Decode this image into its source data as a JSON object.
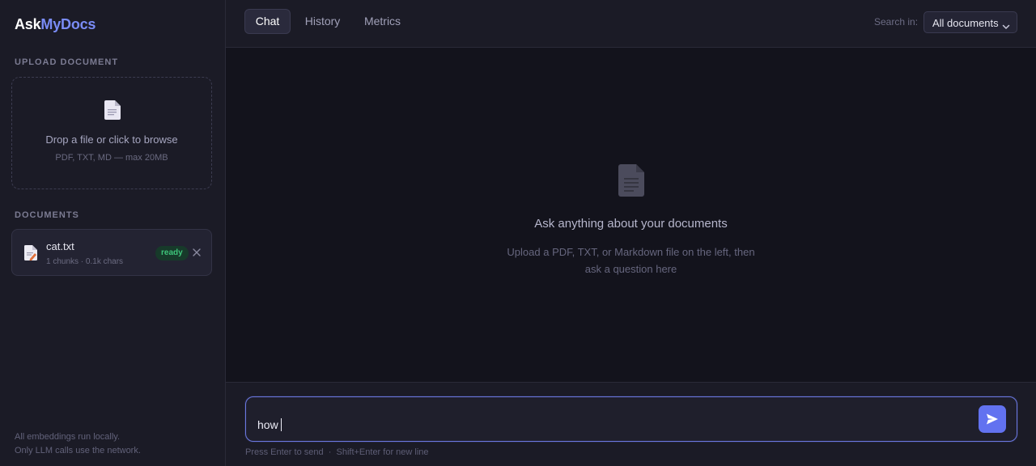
{
  "app": {
    "logo_a": "Ask",
    "logo_b": "MyDocs"
  },
  "sidebar": {
    "upload_label": "UPLOAD DOCUMENT",
    "dropzone": {
      "title": "Drop a file or click to browse",
      "subtitle": "PDF, TXT, MD — max 20MB",
      "icon": "document-icon"
    },
    "documents_label": "DOCUMENTS",
    "documents": [
      {
        "name": "cat.txt",
        "meta": "1 chunks · 0.1k chars",
        "status": "ready",
        "icon": "text-file-icon"
      }
    ],
    "footnote_line1": "All embeddings run locally.",
    "footnote_line2": "Only LLM calls use the network."
  },
  "header": {
    "tabs": [
      {
        "label": "Chat",
        "active": true
      },
      {
        "label": "History",
        "active": false
      },
      {
        "label": "Metrics",
        "active": false
      }
    ],
    "search_label": "Search in:",
    "search_scope": "All documents"
  },
  "main": {
    "empty_title": "Ask anything about your documents",
    "empty_sub_line1": "Upload a PDF, TXT, or Markdown file on the left, then",
    "empty_sub_line2": "ask a question here"
  },
  "composer": {
    "value": "how",
    "hint": "Press Enter to send  ·  Shift+Enter for new line"
  },
  "colors": {
    "accent": "#6272f0",
    "logo_accent": "#7a8cf6",
    "ready": "#3ec47a",
    "background": "#13131c",
    "panel": "#1b1b26"
  }
}
